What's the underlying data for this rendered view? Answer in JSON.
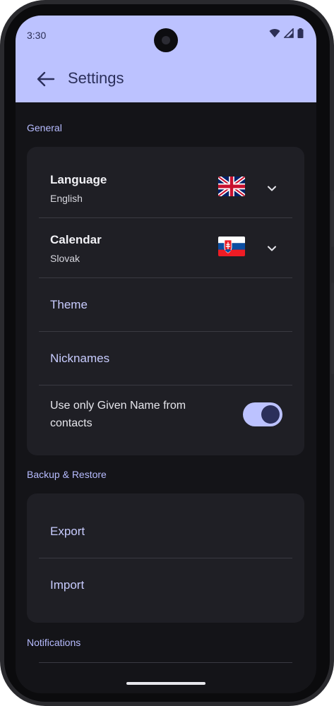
{
  "status": {
    "time": "3:30"
  },
  "app_bar": {
    "title": "Settings"
  },
  "sections": {
    "general": "General",
    "backup": "Backup & Restore",
    "notifications": "Notifications"
  },
  "general": {
    "language": {
      "title": "Language",
      "value": "English"
    },
    "calendar": {
      "title": "Calendar",
      "value": "Slovak"
    },
    "theme": "Theme",
    "nicknames": "Nicknames",
    "given_name": {
      "label": "Use only Given Name from contacts",
      "enabled": true
    }
  },
  "backup": {
    "export": "Export",
    "import": "Import"
  },
  "colors": {
    "top_bar": "#bcc2ff",
    "accent": "#b7bcff",
    "background": "#141418",
    "card": "#1f1f25"
  }
}
